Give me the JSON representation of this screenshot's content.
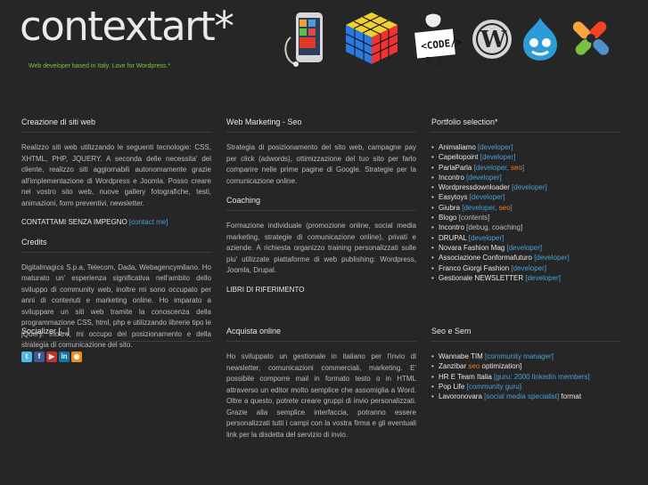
{
  "site": {
    "logo": "contextart*",
    "tagline": "Web developer based in Italy. Love for Wordpress.*"
  },
  "header_icons": [
    "phone-icon",
    "rubiks-cube-icon",
    "code-newspaper-man-icon",
    "wordpress-icon",
    "drupal-icon",
    "joomla-icon"
  ],
  "col1": {
    "creazione_title": "Creazione di siti web",
    "creazione_text": "Realizzo siti web utilizzando le seguenti tecnologie: CSS, XHTML, PHP, JQUERY. A seconda delle necessita' del cliente, realizzo siti aggiornabili autonomamente grazie all'implementazione di Wordpress e Joomla. Posso creare nel vostro sito web, nuove gallery fotografiche, testi, animazioni, form preventivi, newsletter.",
    "contact_text": "CONTATTAMI SENZA IMPEGNO",
    "contact_link": "[contact me]",
    "credits_title": "Credits",
    "credits_text": "Digitalmagics S.p.a, Telecom, Dada, Webagencymilano. Ho maturato un' esperienza significativa nell'ambito dello sviluppo di community web, inoltre mi sono occupato per anni di contenuti e marketing online. Ho imparato a sviluppare un siti web tramite la conoscenza della programmazione CSS, html, php e utilizzando librerie tipo le jQuery. Inoltre, mi occupo del posizionamento e della strategia di comunicazione del sito.",
    "socializer_title": "Socializer [...]"
  },
  "col2": {
    "webmarketing_title": "Web Marketing - Seo",
    "webmarketing_text": "Strategia di posizionamento del sito web, campagne pay per click (adwords), ottimizzazione del tuo sito per farlo comparire nelle prime pagine di Google. Strategie per la comunicazione online.",
    "coaching_title": "Coaching",
    "coaching_text": "Formazione individuale (promozione online, social media marketing, strategie di comunicazione online), privati e aziende. A richiesta organizzo training personalizzati sulle piu' utilizzate piattaforme di web publishing: Wordpress, Joomla, Drupal.",
    "libri": "LIBRI DI RIFERIMENTO",
    "acquista_title": "Acquista online",
    "acquista_text": "Ho sviluppato un gestionale in italiano per l'invio di newsletter, comunicazioni commerciali, marketing. E' possibile comporre mail in formato testo o in HTML attraverso un editor molto semplice che assomiglia a Word. Oltre a questo, potrete creare gruppi di invio personalizzati. Grazie alla semplice interfaccia, potranno essere personalizzati tutti i campi con la vostra firma e gli eventuali link per la disdetta del servizio di invio."
  },
  "col3": {
    "portfolio_title": "Portfolio selection*",
    "portfolio": [
      {
        "name": "Animaliamo",
        "tag": "[developer]"
      },
      {
        "name": "Capellopoint",
        "tag": "[developer]"
      },
      {
        "name": "ParlaParla",
        "tag": "[developer, seo]"
      },
      {
        "name": "Incontro",
        "tag": "[developer]"
      },
      {
        "name": "Wordpressdownloader",
        "tag": "[developer]"
      },
      {
        "name": "Easytoys",
        "tag": "[developer]"
      },
      {
        "name": "Giubra",
        "tag": "[developer, seo]"
      },
      {
        "name": "Blogo",
        "tag": "[contents]"
      },
      {
        "name": "Incontro",
        "tag": "[debug, coaching]"
      },
      {
        "name": "DRUPAL",
        "tag": "[developer]"
      },
      {
        "name": "Novara Fashion Mag",
        "tag": "[developer]"
      },
      {
        "name": "Associazione Conformafuturo",
        "tag": "[developer]"
      },
      {
        "name": "Franco Giorgi Fashion",
        "tag": "[developer]"
      },
      {
        "name": "Gestionale NEWSLETTER",
        "tag": "[developer]"
      }
    ],
    "seo_title": "Seo e Sem",
    "seo": [
      {
        "name": "Wannabe TIM",
        "tag": "[community manager]",
        "suffix": ""
      },
      {
        "name": "Zanzibar",
        "tag": "seo",
        "suffix": "optimization]"
      },
      {
        "name": "HR E Team Italia",
        "tag": "[guru: 2000 linkedin members]",
        "suffix": ""
      },
      {
        "name": "Pop Life",
        "tag": "[community guru]",
        "suffix": ""
      },
      {
        "name": "Lavoronovara",
        "tag": "[social media specialist]",
        "suffix": "format"
      }
    ]
  },
  "social": [
    {
      "name": "twitter-icon",
      "glyph": "t",
      "color": "#4fb8e8"
    },
    {
      "name": "facebook-icon",
      "glyph": "f",
      "color": "#3b5b98"
    },
    {
      "name": "youtube-icon",
      "glyph": "▶",
      "color": "#c4302b"
    },
    {
      "name": "linkedin-icon",
      "glyph": "in",
      "color": "#0e76a8"
    },
    {
      "name": "rss-icon",
      "glyph": "◉",
      "color": "#f28a19"
    }
  ]
}
